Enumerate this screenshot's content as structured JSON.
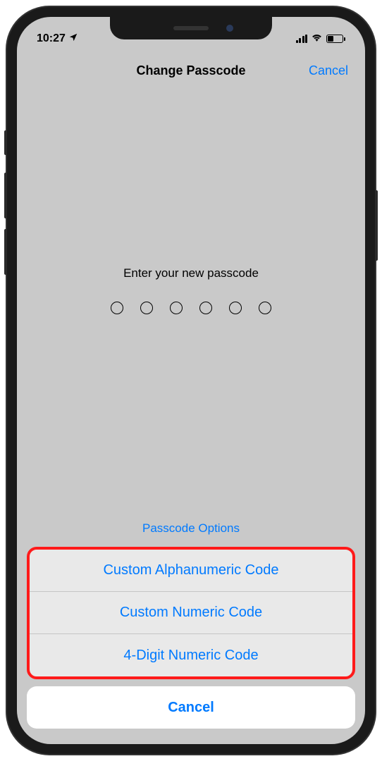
{
  "statusBar": {
    "time": "10:27"
  },
  "navBar": {
    "title": "Change Passcode",
    "cancel": "Cancel"
  },
  "content": {
    "prompt": "Enter your new passcode",
    "passcodeLength": 6,
    "optionsLink": "Passcode Options"
  },
  "actionSheet": {
    "options": [
      "Custom Alphanumeric Code",
      "Custom Numeric Code",
      "4-Digit Numeric Code"
    ],
    "cancel": "Cancel"
  }
}
